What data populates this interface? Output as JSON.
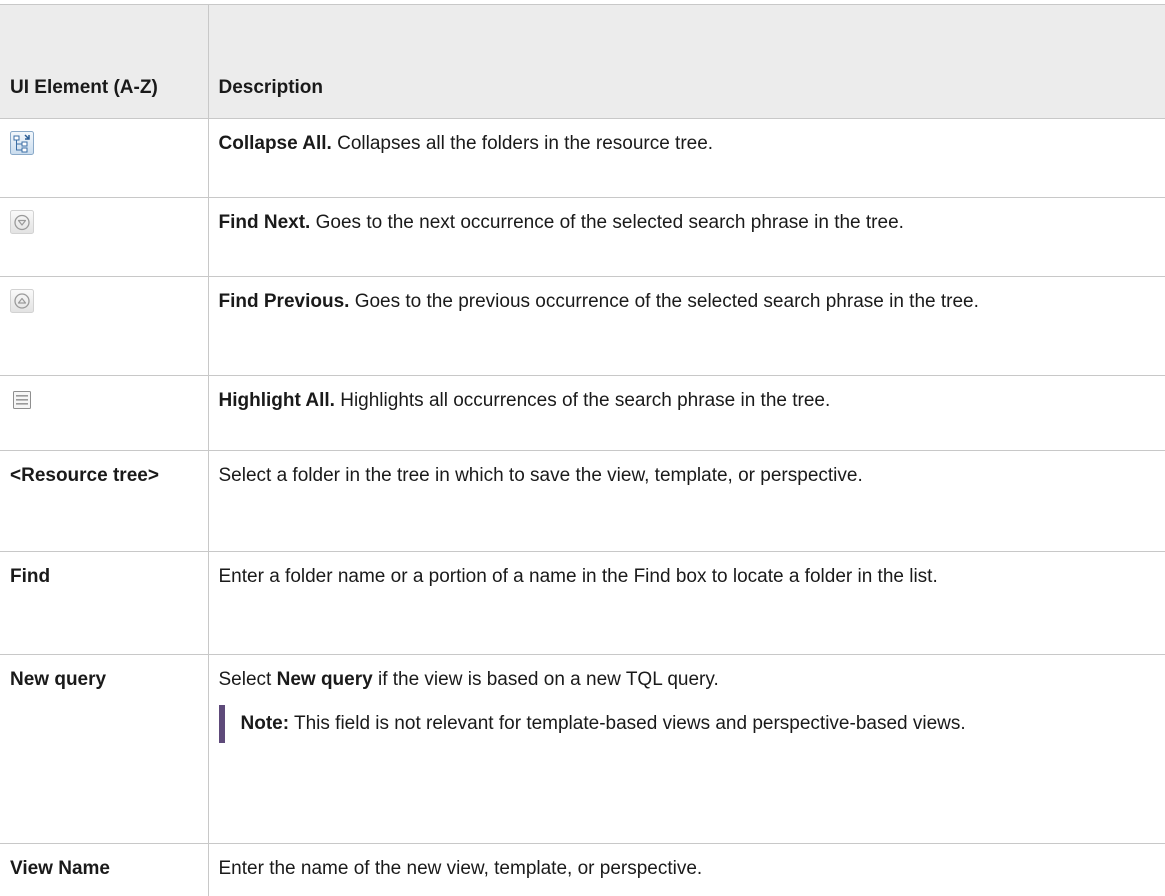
{
  "header": {
    "col1": "UI Element (A-Z)",
    "col2": "Description"
  },
  "rows": [
    {
      "icon": "collapse-all-icon",
      "term": "Collapse All.",
      "desc": " Collapses all the folders in the resource tree."
    },
    {
      "icon": "find-next-icon",
      "term": "Find Next.",
      "desc": " Goes to the next occurrence of the selected search phrase in the tree."
    },
    {
      "icon": "find-previous-icon",
      "term": "Find Previous.",
      "desc": " Goes to the previous occurrence of the selected search phrase in the tree."
    },
    {
      "icon": "highlight-all-icon",
      "term": "Highlight All.",
      "desc": " Highlights all occurrences of the search phrase in the tree."
    },
    {
      "element": "<Resource tree>",
      "desc": "Select a folder in the tree in which to save the view, template, or perspective."
    },
    {
      "element": "Find",
      "desc": "Enter a folder name or a portion of a name in the Find box to locate a folder in the list."
    },
    {
      "element": "New query",
      "desc_pre": "Select ",
      "desc_bold": "New query",
      "desc_post": " if the view is based on a new TQL query.",
      "note_label": "Note:",
      "note_text": "  This field is not relevant for template-based views and perspective-based views."
    },
    {
      "element": "View Name",
      "desc": "Enter the name of the new view, template, or perspective."
    }
  ]
}
